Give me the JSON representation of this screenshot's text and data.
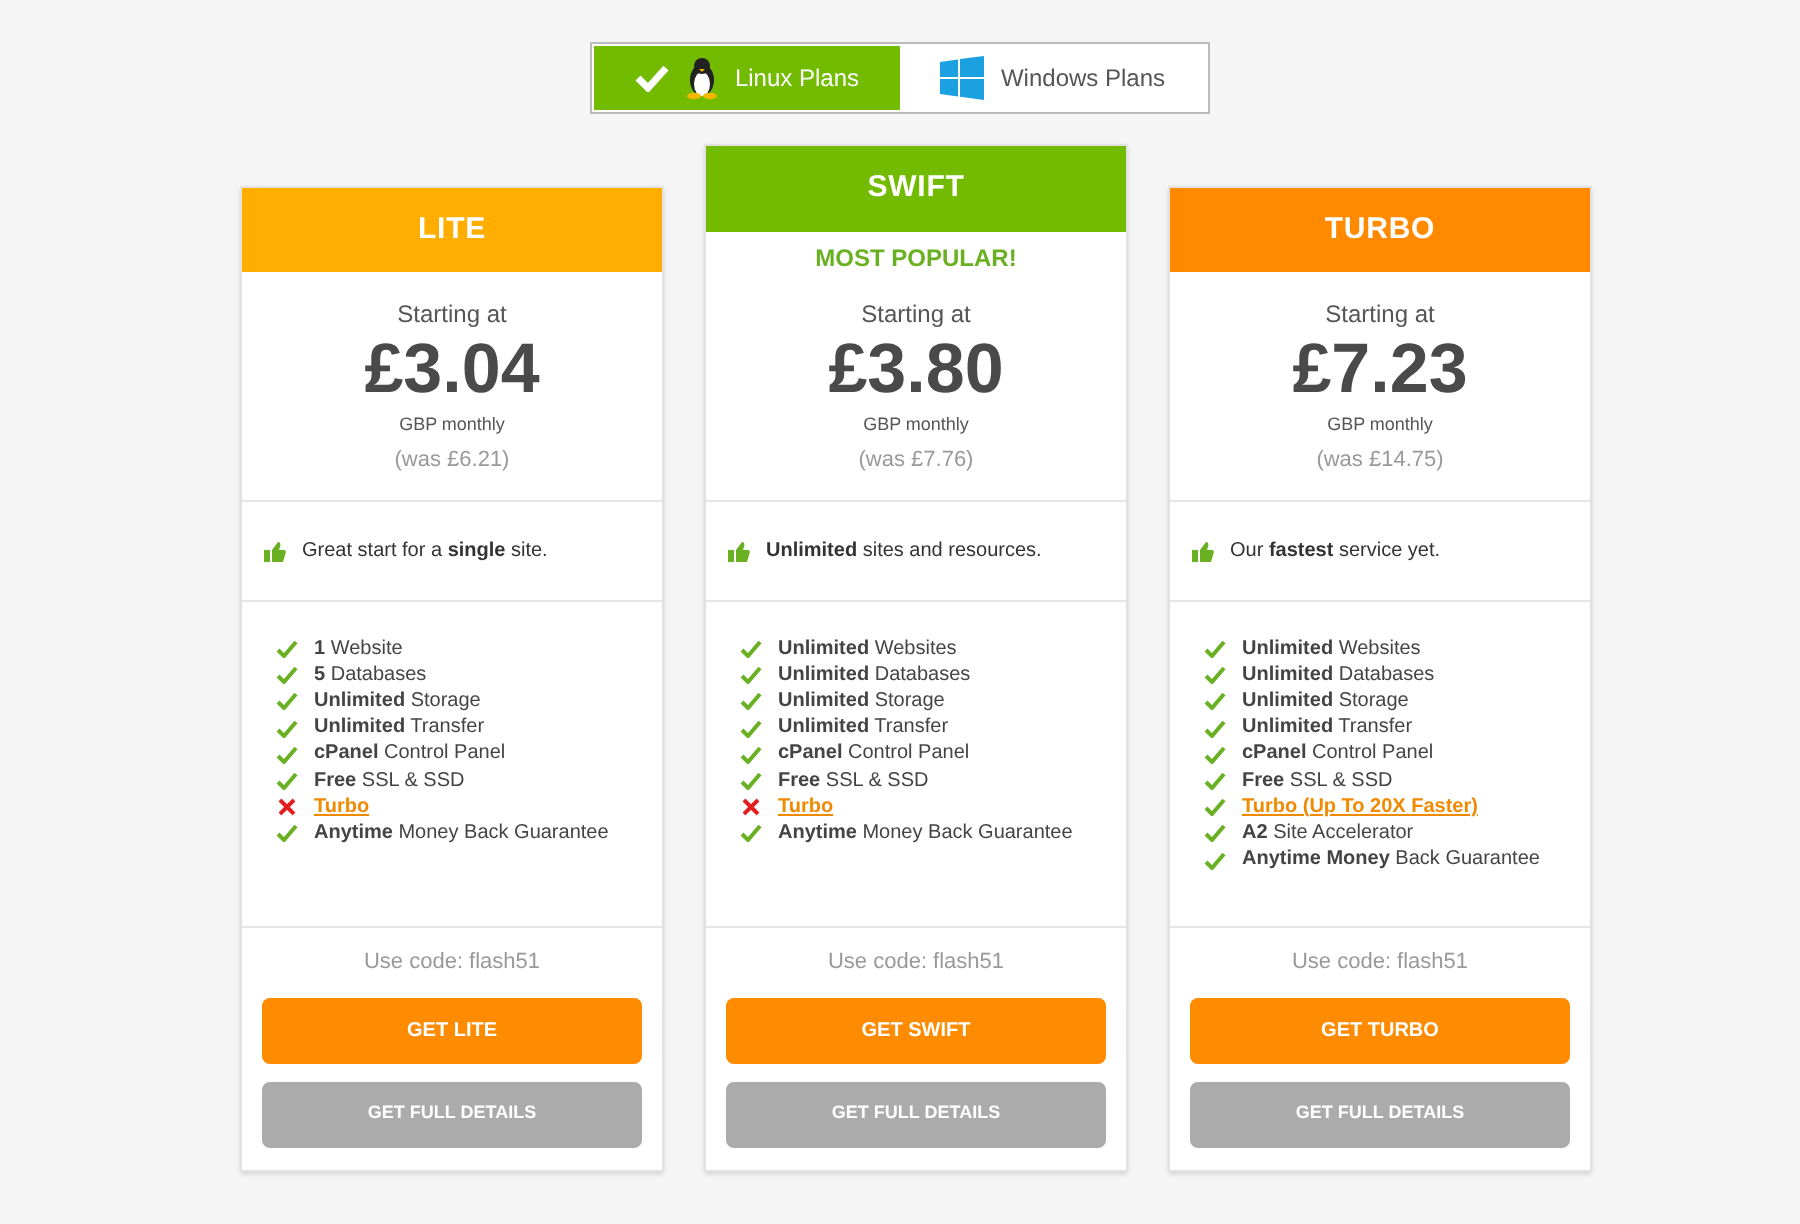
{
  "tabs": [
    {
      "label": "Linux Plans",
      "selected": true,
      "kind": "linux"
    },
    {
      "label": "Windows Plans",
      "selected": false,
      "kind": "windows"
    }
  ],
  "plans": [
    {
      "name": "LITE",
      "color": "#ffae00",
      "featured": false,
      "starting": "Starting at",
      "price": "£3.04",
      "period": "GBP monthly",
      "was": "(was £6.21)",
      "tagline": "Great start for a **single** site.",
      "features": [
        {
          "text": "**1** Website",
          "included": true,
          "kind": "text"
        },
        {
          "text": "**5** Databases",
          "included": true,
          "kind": "text"
        },
        {
          "text": "**Unlimited** Storage",
          "included": true,
          "kind": "text"
        },
        {
          "text": "**Unlimited** Transfer",
          "included": true,
          "kind": "text"
        },
        {
          "text": "**cPanel** Control Panel",
          "included": true,
          "kind": "text"
        },
        {
          "text": "**Free** SSL & SSD",
          "included": true,
          "kind": "text"
        },
        {
          "text": "Turbo",
          "included": false,
          "kind": "link"
        },
        {
          "text": "**Anytime** Money Back Guarantee",
          "included": true,
          "kind": "text"
        }
      ],
      "code": "Use code: flash51",
      "cta": "GET LITE",
      "details": "GET FULL DETAILS"
    },
    {
      "name": "SWIFT",
      "color": "#72bb00",
      "featured": true,
      "badge": "MOST POPULAR!",
      "starting": "Starting at",
      "price": "£3.80",
      "period": "GBP monthly",
      "was": "(was £7.76)",
      "tagline": "**Unlimited** sites and resources.",
      "features": [
        {
          "text": "**Unlimited** Websites",
          "included": true,
          "kind": "text"
        },
        {
          "text": "**Unlimited** Databases",
          "included": true,
          "kind": "text"
        },
        {
          "text": "**Unlimited** Storage",
          "included": true,
          "kind": "text"
        },
        {
          "text": "**Unlimited** Transfer",
          "included": true,
          "kind": "text"
        },
        {
          "text": "**cPanel** Control Panel",
          "included": true,
          "kind": "text"
        },
        {
          "text": "**Free** SSL & SSD",
          "included": true,
          "kind": "text"
        },
        {
          "text": "Turbo",
          "included": false,
          "kind": "link"
        },
        {
          "text": "**Anytime** Money Back Guarantee",
          "included": true,
          "kind": "text"
        }
      ],
      "code": "Use code: flash51",
      "cta": "GET SWIFT",
      "details": "GET FULL DETAILS"
    },
    {
      "name": "TURBO",
      "color": "#ff8a00",
      "featured": false,
      "starting": "Starting at",
      "price": "£7.23",
      "period": "GBP monthly",
      "was": "(was £14.75)",
      "tagline": "Our **fastest** service yet.",
      "features": [
        {
          "text": "**Unlimited** Websites",
          "included": true,
          "kind": "text"
        },
        {
          "text": "**Unlimited** Databases",
          "included": true,
          "kind": "text"
        },
        {
          "text": "**Unlimited** Storage",
          "included": true,
          "kind": "text"
        },
        {
          "text": "**Unlimited** Transfer",
          "included": true,
          "kind": "text"
        },
        {
          "text": "**cPanel** Control Panel",
          "included": true,
          "kind": "text"
        },
        {
          "text": "**Free** SSL & SSD",
          "included": true,
          "kind": "text"
        },
        {
          "text": "Turbo (Up To 20X Faster)",
          "included": true,
          "kind": "link"
        },
        {
          "text": "**A2** Site Accelerator",
          "included": true,
          "kind": "text"
        },
        {
          "text": "**Anytime Money** Back Guarantee",
          "included": true,
          "kind": "text"
        }
      ],
      "code": "Use code: flash51",
      "cta": "GET TURBO",
      "details": "GET FULL DETAILS"
    }
  ]
}
